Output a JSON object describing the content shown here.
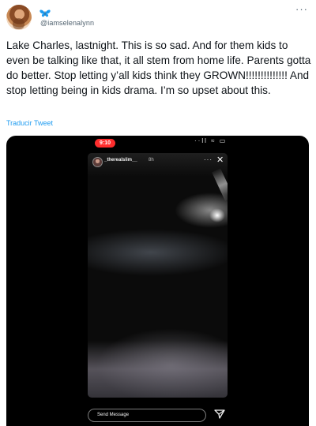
{
  "tweet": {
    "handle": "@iamselenalynn",
    "text": "Lake Charles, lastnight. This is so sad. And for them kids to even be talking like that, it all stem from home life. Parents gotta do better. Stop letting y’all kids think they GROWN!!!!!!!!!!!!!! And stop letting being in kids drama. I’m so upset about this.",
    "translate_label": "Traducir Tweet",
    "more_label": "···",
    "name_icon": "butterfly-icon"
  },
  "media": {
    "status_time": "9:10",
    "status_icons": "··ll ≈ ▭",
    "story_user": "_therealslim__",
    "story_age": "8h",
    "story_more": "···",
    "story_close": "✕",
    "send_placeholder": "Send Message"
  },
  "colors": {
    "handle": "#536471",
    "link": "#1d9bf0",
    "butterfly": "#1d9bf0",
    "status_time_bg": "#ff2d2d"
  }
}
